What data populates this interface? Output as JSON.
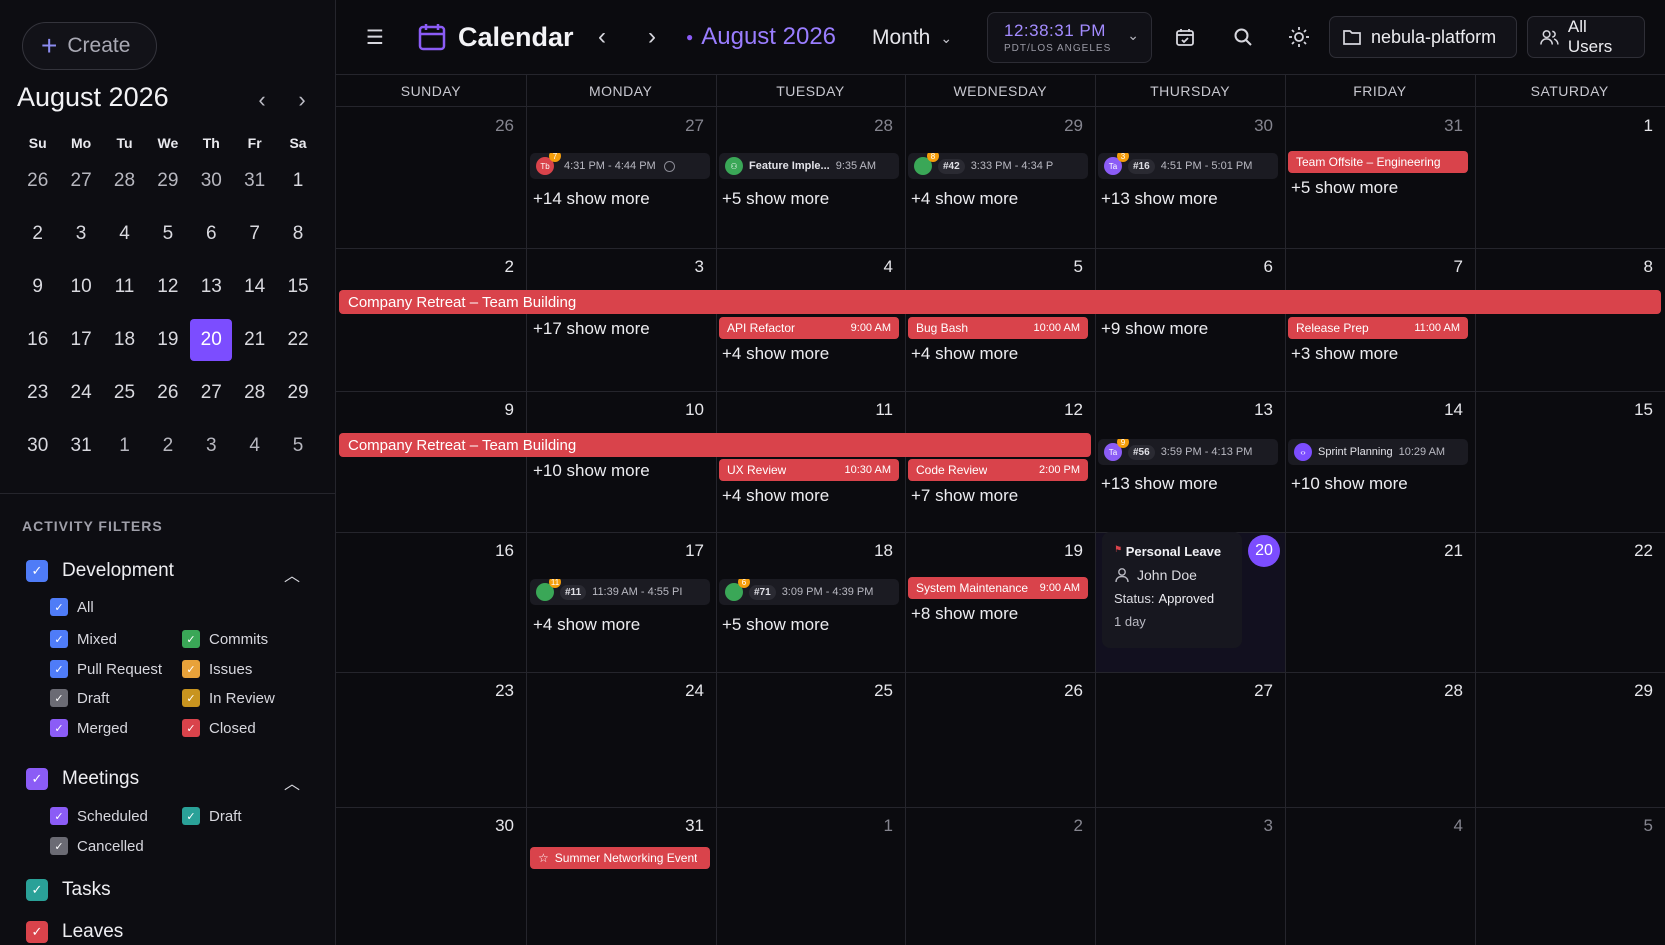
{
  "sidebar": {
    "create_label": "Create",
    "mini_title": "August 2026",
    "weekdays": [
      "Su",
      "Mo",
      "Tu",
      "We",
      "Th",
      "Fr",
      "Sa"
    ],
    "weeks": [
      [
        "26",
        "27",
        "28",
        "29",
        "30",
        "31",
        "1"
      ],
      [
        "2",
        "3",
        "4",
        "5",
        "6",
        "7",
        "8"
      ],
      [
        "9",
        "10",
        "11",
        "12",
        "13",
        "14",
        "15"
      ],
      [
        "16",
        "17",
        "18",
        "19",
        "20",
        "21",
        "22"
      ],
      [
        "23",
        "24",
        "25",
        "26",
        "27",
        "28",
        "29"
      ],
      [
        "30",
        "31",
        "1",
        "2",
        "3",
        "4",
        "5"
      ]
    ],
    "selected_day": "20",
    "filters_heading": "ACTIVITY FILTERS",
    "development": {
      "label": "Development",
      "color": "#4f7cf7",
      "items": [
        {
          "label": "All",
          "color": "#4f7cf7"
        },
        {
          "label": "Mixed",
          "color": "#4f7cf7"
        },
        {
          "label": "Commits",
          "color": "#3aa757"
        },
        {
          "label": "Pull Request",
          "color": "#4f7cf7"
        },
        {
          "label": "Issues",
          "color": "#e8a23a"
        },
        {
          "label": "Draft",
          "color": "#6b6b74"
        },
        {
          "label": "In Review",
          "color": "#c8941f"
        },
        {
          "label": "Merged",
          "color": "#8b5cf6"
        },
        {
          "label": "Closed",
          "color": "#d9434b"
        }
      ]
    },
    "meetings": {
      "label": "Meetings",
      "color": "#8b5cf6",
      "items": [
        {
          "label": "Scheduled",
          "color": "#8b5cf6"
        },
        {
          "label": "Draft",
          "color": "#2aa198"
        },
        {
          "label": "Cancelled",
          "color": "#6b6b74"
        }
      ]
    },
    "tasks": {
      "label": "Tasks",
      "color": "#2aa198"
    },
    "leaves": {
      "label": "Leaves",
      "color": "#d9434b"
    }
  },
  "topbar": {
    "title": "Calendar",
    "month": "August 2026",
    "view": "Month",
    "clock_time": "12:38:31 PM",
    "clock_tz": "PDT/LOS ANGELES",
    "project": "nebula-platform",
    "users": "All Users"
  },
  "calendar": {
    "weekdays": [
      "SUNDAY",
      "MONDAY",
      "TUESDAY",
      "WEDNESDAY",
      "THURSDAY",
      "FRIDAY",
      "SATURDAY"
    ],
    "weeks": [
      [
        "26",
        "27",
        "28",
        "29",
        "30",
        "31",
        "1"
      ],
      [
        "2",
        "3",
        "4",
        "5",
        "6",
        "7",
        "8"
      ],
      [
        "9",
        "10",
        "11",
        "12",
        "13",
        "14",
        "15"
      ],
      [
        "16",
        "17",
        "18",
        "19",
        "20",
        "21",
        "22"
      ],
      [
        "23",
        "24",
        "25",
        "26",
        "27",
        "28",
        "29"
      ],
      [
        "30",
        "31",
        "1",
        "2",
        "3",
        "4",
        "5"
      ]
    ],
    "today": "20",
    "events": {
      "w1_mon": {
        "badge": "7",
        "avatar": "Tb",
        "time": "4:31 PM - 4:44 PM",
        "more": "+14 show more"
      },
      "w1_tue": {
        "title": "Feature Imple...",
        "time": "9:35 AM",
        "more": "+5 show more"
      },
      "w1_wed": {
        "badge": "8",
        "pr": "#42",
        "time": "3:33 PM - 4:34 P",
        "more": "+4 show more"
      },
      "w1_thu": {
        "badge": "3",
        "avatar": "Ta",
        "pr": "#16",
        "time": "4:51 PM - 5:01 PM",
        "more": "+13 show more"
      },
      "w1_fri": {
        "title": "Team Offsite – Engineering",
        "more": "+5 show more"
      },
      "w2_banner": "Company Retreat – Team Building",
      "w2_mon_more": "+17 show more",
      "w2_tue": {
        "title": "API Refactor",
        "time": "9:00 AM",
        "more": "+4 show more"
      },
      "w2_wed": {
        "title": "Bug Bash",
        "time": "10:00 AM",
        "more": "+4 show more"
      },
      "w2_thu_more": "+9 show more",
      "w2_fri": {
        "title": "Release Prep",
        "time": "11:00 AM",
        "more": "+3 show more"
      },
      "w3_banner": "Company Retreat – Team Building",
      "w3_mon_more": "+10 show more",
      "w3_tue": {
        "title": "UX Review",
        "time": "10:30 AM",
        "more": "+4 show more"
      },
      "w3_wed": {
        "title": "Code Review",
        "time": "2:00 PM",
        "more": "+7 show more"
      },
      "w3_thu": {
        "badge": "9",
        "avatar": "Ta",
        "pr": "#56",
        "time": "3:59 PM - 4:13 PM",
        "more": "+13 show more"
      },
      "w3_fri": {
        "title": "Sprint Planning",
        "time": "10:29 AM",
        "more": "+10 show more"
      },
      "w4_mon": {
        "badge": "11",
        "pr": "#11",
        "time": "11:39 AM - 4:55 PI",
        "more": "+4 show more"
      },
      "w4_tue": {
        "badge": "6",
        "pr": "#71",
        "time": "3:09 PM - 4:39 PM",
        "more": "+5 show more"
      },
      "w4_wed": {
        "title": "System Maintenance",
        "time": "9:00 AM",
        "more": "+8 show more"
      },
      "leave": {
        "title": "Personal Leave",
        "person": "John Doe",
        "status_label": "Status:",
        "status": "Approved",
        "duration": "1 day"
      },
      "w6_mon": {
        "title": "Summer Networking Event"
      }
    }
  }
}
